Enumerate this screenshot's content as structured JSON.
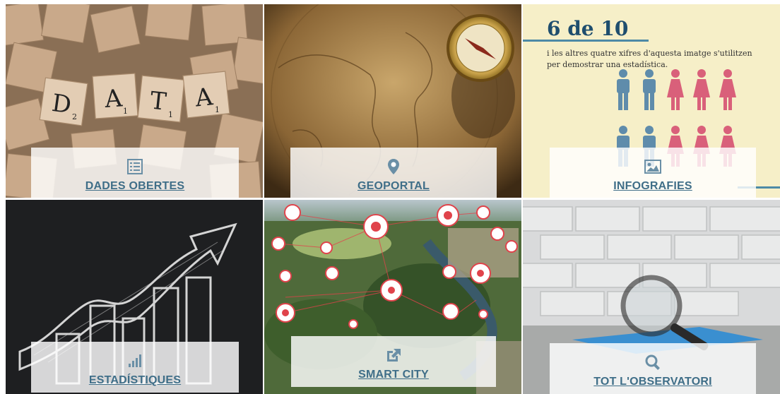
{
  "tiles": [
    {
      "label": "DADES OBERTES",
      "icon": "list-icon"
    },
    {
      "label": "GEOPORTAL",
      "icon": "map-pin-icon"
    },
    {
      "label": "INFOGRAFIES",
      "icon": "image-icon"
    },
    {
      "label": "ESTADÍSTIQUES",
      "icon": "bar-chart-icon"
    },
    {
      "label": "SMART CITY",
      "icon": "external-link-icon"
    },
    {
      "label": "TOT L'OBSERVATORI",
      "icon": "search-icon"
    }
  ],
  "scrabble": {
    "letters": [
      "D",
      "A",
      "T",
      "A"
    ],
    "subscripts": [
      "2",
      "1",
      "1",
      "1"
    ]
  },
  "infographic": {
    "title": "6 de 10",
    "text": "i les altres quatre xifres d'aquesta imatge s'utilitzen per demostrar una estadística."
  },
  "colors": {
    "label": "#3f6e88",
    "icon": "#6a8fa6",
    "infographic_title": "#1f4e6e",
    "male_figure": "#5f8cab",
    "female_figure": "#d9607a",
    "smart_city_red": "#e0434b"
  }
}
